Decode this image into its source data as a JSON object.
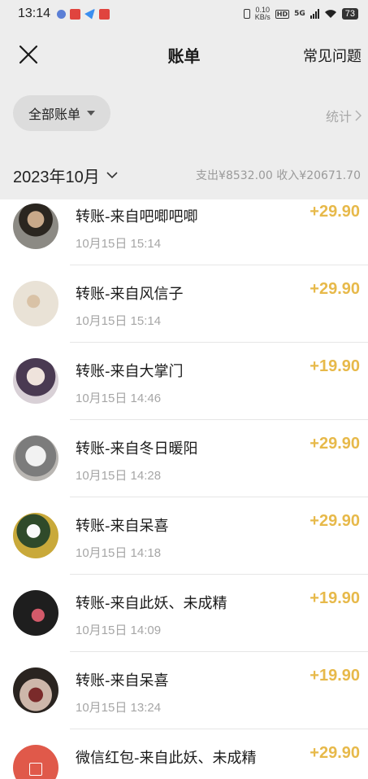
{
  "status_bar": {
    "time": "13:14",
    "net_speed": "0.10",
    "net_unit": "KB/s",
    "hd": "HD",
    "net_type": "5G",
    "battery": "73"
  },
  "nav": {
    "close_icon": "close-icon",
    "title": "账单",
    "faq": "常见问题"
  },
  "filter": {
    "label": "全部账单",
    "stats": "统计"
  },
  "month": {
    "label": "2023年10月",
    "summary": "支出¥8532.00 收入¥20671.70"
  },
  "colors": {
    "amount": "#e7b94a",
    "header_bg": "#ededed"
  },
  "transactions": [
    {
      "title": "转账-来自吧唧吧唧",
      "time": "10月15日 15:14",
      "amount": "+29.90"
    },
    {
      "title": "转账-来自风信子",
      "time": "10月15日 15:14",
      "amount": "+29.90"
    },
    {
      "title": "转账-来自大掌门",
      "time": "10月15日 14:46",
      "amount": "+19.90"
    },
    {
      "title": "转账-来自冬日暖阳",
      "time": "10月15日 14:28",
      "amount": "+29.90"
    },
    {
      "title": "转账-来自呆喜",
      "time": "10月15日 14:18",
      "amount": "+29.90"
    },
    {
      "title": "转账-来自此妖、未成精",
      "time": "10月15日 14:09",
      "amount": "+19.90"
    },
    {
      "title": "转账-来自呆喜",
      "time": "10月15日 13:24",
      "amount": "+19.90"
    },
    {
      "title": "微信红包-来自此妖、未成精",
      "time": "",
      "amount": "+29.90"
    }
  ]
}
